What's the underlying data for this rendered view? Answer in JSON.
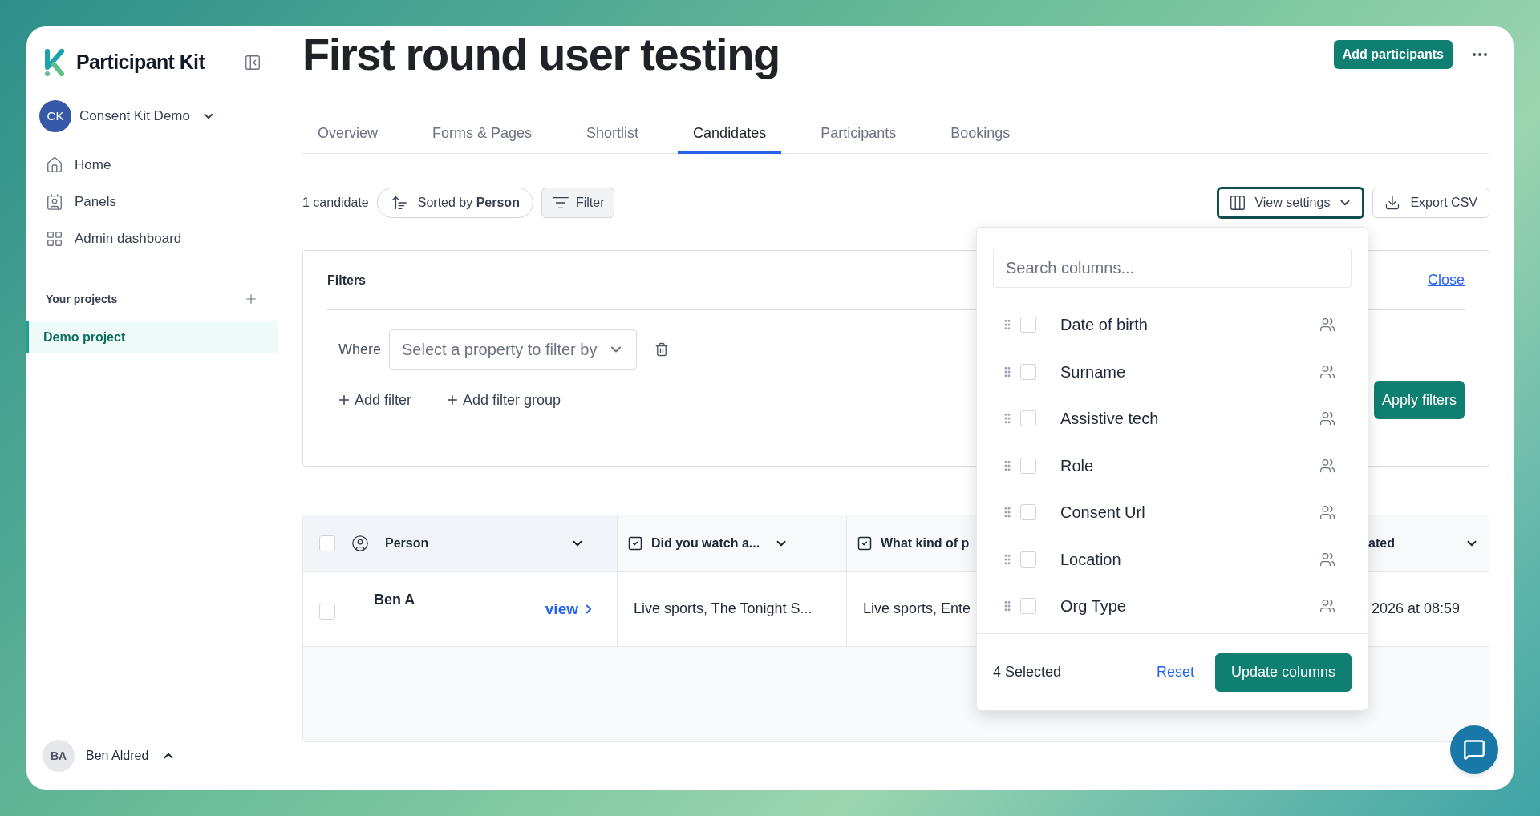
{
  "sidebar": {
    "brand": "Participant Kit",
    "workspace": {
      "initials": "CK",
      "name": "Consent Kit Demo"
    },
    "nav": [
      {
        "label": "Home"
      },
      {
        "label": "Panels"
      },
      {
        "label": "Admin dashboard"
      }
    ],
    "projects_heading": "Your projects",
    "projects": [
      {
        "label": "Demo project",
        "selected": true
      }
    ],
    "user": {
      "initials": "BA",
      "name": "Ben Aldred"
    }
  },
  "header": {
    "title": "First round user testing",
    "primary_button": "Add participants"
  },
  "tabs": [
    {
      "label": "Overview",
      "selected": false
    },
    {
      "label": "Forms & Pages",
      "selected": false
    },
    {
      "label": "Shortlist",
      "selected": false
    },
    {
      "label": "Candidates",
      "selected": true
    },
    {
      "label": "Participants",
      "selected": false
    },
    {
      "label": "Bookings",
      "selected": false
    }
  ],
  "toolbar": {
    "count": "1 candidate",
    "sort": "Sorted by **Person**",
    "filter": "Filter",
    "view_settings": "View settings",
    "export": "Export CSV"
  },
  "filters": {
    "title": "Filters",
    "close": "Close",
    "where": "Where",
    "property_placeholder": "Select a property to filter by",
    "add_filter": "Add filter",
    "add_group": "Add filter group",
    "apply": "Apply filters"
  },
  "table": {
    "select_all_checked": false,
    "columns": [
      {
        "label": "Person",
        "kind": "person"
      },
      {
        "label": "Did you watch a...",
        "kind": "question"
      },
      {
        "label": "What kind of p",
        "kind": "question"
      },
      {
        "label": "ated",
        "kind": "date"
      }
    ],
    "rows": [
      {
        "checked": false,
        "cells": [
          "Ben A",
          "Live sports, The Tonight S...",
          "Live sports, Ente",
          "2026 at 08:59"
        ],
        "link": "view"
      }
    ]
  },
  "column_menu": {
    "search_placeholder": "Search columns...",
    "items": [
      {
        "label": "Date of birth",
        "checked": false
      },
      {
        "label": "Surname",
        "checked": false
      },
      {
        "label": "Assistive tech",
        "checked": false
      },
      {
        "label": "Role",
        "checked": false
      },
      {
        "label": "Consent Url",
        "checked": false
      },
      {
        "label": "Location",
        "checked": false
      },
      {
        "label": "Org Type",
        "checked": false
      }
    ],
    "selected_count": "4 Selected",
    "reset": "Reset",
    "update": "Update columns"
  }
}
